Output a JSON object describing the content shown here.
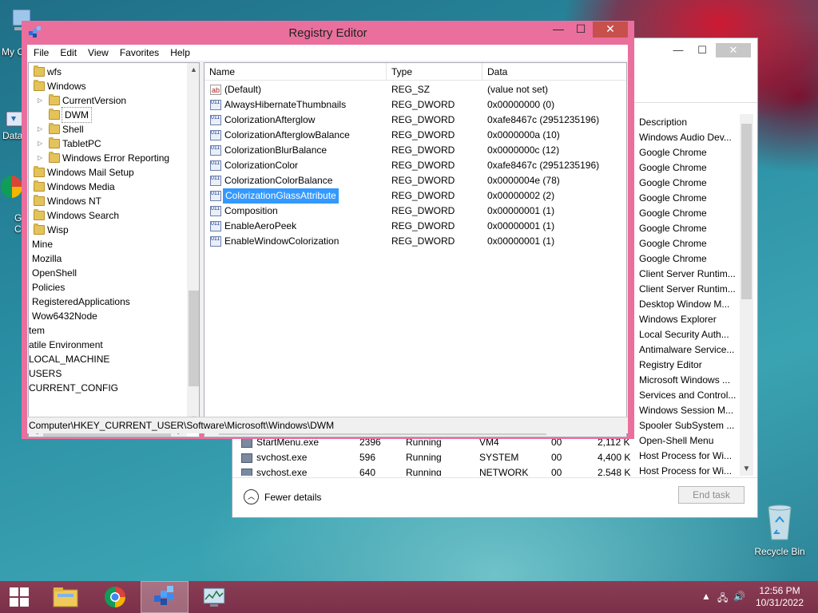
{
  "desktop": {
    "icons": [
      {
        "label": "My C",
        "name": "computer"
      },
      {
        "label": "Data",
        "name": "data"
      },
      {
        "label": "G\nC",
        "name": "chrome"
      },
      {
        "label": "Recycle Bin",
        "name": "recycle-bin"
      }
    ]
  },
  "registry": {
    "title": "Registry Editor",
    "menu": [
      "File",
      "Edit",
      "View",
      "Favorites",
      "Help"
    ],
    "tree": [
      {
        "label": "wfs",
        "indent": 1,
        "expander": "",
        "folder": true
      },
      {
        "label": "Windows",
        "indent": 1,
        "expander": "",
        "folder": true
      },
      {
        "label": "CurrentVersion",
        "indent": 2,
        "expander": "▷",
        "folder": true
      },
      {
        "label": "DWM",
        "indent": 2,
        "expander": "",
        "folder": true,
        "selected": true
      },
      {
        "label": "Shell",
        "indent": 2,
        "expander": "▷",
        "folder": true
      },
      {
        "label": "TabletPC",
        "indent": 2,
        "expander": "▷",
        "folder": true
      },
      {
        "label": "Windows Error Reporting",
        "indent": 2,
        "expander": "▷",
        "folder": true
      },
      {
        "label": "Windows Mail Setup",
        "indent": 1,
        "expander": "",
        "folder": true
      },
      {
        "label": "Windows Media",
        "indent": 1,
        "expander": "",
        "folder": true
      },
      {
        "label": "Windows NT",
        "indent": 1,
        "expander": "",
        "folder": true
      },
      {
        "label": "Windows Search",
        "indent": 1,
        "expander": "",
        "folder": true
      },
      {
        "label": "Wisp",
        "indent": 1,
        "expander": "",
        "folder": true
      },
      {
        "label": "Mine",
        "indent": 0,
        "expander": "",
        "folder": false
      },
      {
        "label": "Mozilla",
        "indent": 0,
        "expander": "",
        "folder": false
      },
      {
        "label": "OpenShell",
        "indent": 0,
        "expander": "",
        "folder": false
      },
      {
        "label": "Policies",
        "indent": 0,
        "expander": "",
        "folder": false
      },
      {
        "label": "RegisteredApplications",
        "indent": 0,
        "expander": "",
        "folder": false
      },
      {
        "label": "Wow6432Node",
        "indent": 0,
        "expander": "",
        "folder": false
      },
      {
        "label": "tem",
        "indent": -1,
        "expander": "",
        "folder": false
      },
      {
        "label": "atile Environment",
        "indent": -1,
        "expander": "",
        "folder": false
      },
      {
        "label": "LOCAL_MACHINE",
        "indent": -1,
        "expander": "",
        "folder": false
      },
      {
        "label": "USERS",
        "indent": -1,
        "expander": "",
        "folder": false
      },
      {
        "label": "CURRENT_CONFIG",
        "indent": -1,
        "expander": "",
        "folder": false
      }
    ],
    "columns": {
      "name": "Name",
      "type": "Type",
      "data": "Data"
    },
    "values": [
      {
        "name": "(Default)",
        "type": "REG_SZ",
        "data": "(value not set)",
        "icon": "string"
      },
      {
        "name": "AlwaysHibernateThumbnails",
        "type": "REG_DWORD",
        "data": "0x00000000 (0)",
        "icon": "binary"
      },
      {
        "name": "ColorizationAfterglow",
        "type": "REG_DWORD",
        "data": "0xafe8467c (2951235196)",
        "icon": "binary"
      },
      {
        "name": "ColorizationAfterglowBalance",
        "type": "REG_DWORD",
        "data": "0x0000000a (10)",
        "icon": "binary"
      },
      {
        "name": "ColorizationBlurBalance",
        "type": "REG_DWORD",
        "data": "0x0000000c (12)",
        "icon": "binary"
      },
      {
        "name": "ColorizationColor",
        "type": "REG_DWORD",
        "data": "0xafe8467c (2951235196)",
        "icon": "binary"
      },
      {
        "name": "ColorizationColorBalance",
        "type": "REG_DWORD",
        "data": "0x0000004e (78)",
        "icon": "binary"
      },
      {
        "name": "ColorizationGlassAttribute",
        "type": "REG_DWORD",
        "data": "0x00000002 (2)",
        "icon": "binary",
        "selected": true
      },
      {
        "name": "Composition",
        "type": "REG_DWORD",
        "data": "0x00000001 (1)",
        "icon": "binary"
      },
      {
        "name": "EnableAeroPeek",
        "type": "REG_DWORD",
        "data": "0x00000001 (1)",
        "icon": "binary"
      },
      {
        "name": "EnableWindowColorization",
        "type": "REG_DWORD",
        "data": "0x00000001 (1)",
        "icon": "binary"
      }
    ],
    "status_path": "Computer\\HKEY_CURRENT_USER\\Software\\Microsoft\\Windows\\DWM",
    "frame_color": "#ea6f9d"
  },
  "task_manager": {
    "description_header": "Description",
    "descriptions": [
      "Windows Audio Dev...",
      "Google Chrome",
      "Google Chrome",
      "Google Chrome",
      "Google Chrome",
      "Google Chrome",
      "Google Chrome",
      "Google Chrome",
      "Google Chrome",
      "Client Server Runtim...",
      "Client Server Runtim...",
      "Desktop Window M...",
      "Windows Explorer",
      "Local Security Auth...",
      "Antimalware Service...",
      "Registry Editor",
      "Microsoft Windows ...",
      "Services and Control...",
      "Windows Session M...",
      "Spooler SubSystem ...",
      "Open-Shell Menu",
      "Host Process for Wi...",
      "Host Process for Wi..."
    ],
    "rows": [
      {
        "name": "StartMenu.exe",
        "pid": "2396",
        "status": "Running",
        "user": "VM4",
        "cpu": "00",
        "memory": "2,112 K"
      },
      {
        "name": "svchost.exe",
        "pid": "596",
        "status": "Running",
        "user": "SYSTEM",
        "cpu": "00",
        "memory": "4,400 K"
      },
      {
        "name": "svchost.exe",
        "pid": "640",
        "status": "Running",
        "user": "NETWORK",
        "cpu": "00",
        "memory": "2,548 K"
      }
    ],
    "fewer_details": "Fewer details",
    "end_task": "End task"
  },
  "taskbar": {
    "apps": [
      "start",
      "file-explorer",
      "chrome",
      "registry-editor",
      "task-manager"
    ],
    "active": "registry-editor",
    "time": "12:56 PM",
    "date": "10/31/2022",
    "color": "#7b3049"
  }
}
